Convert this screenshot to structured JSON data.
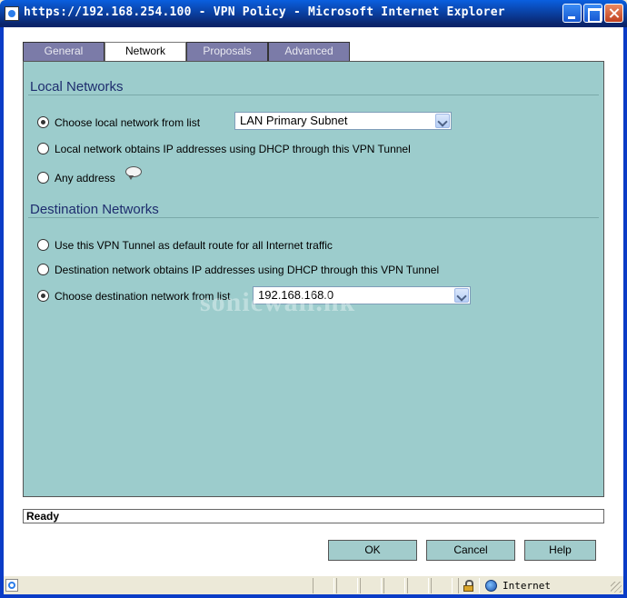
{
  "window": {
    "title": "https://192.168.254.100 - VPN Policy - Microsoft Internet Explorer"
  },
  "tabs": [
    {
      "label": "General",
      "active": false
    },
    {
      "label": "Network",
      "active": true
    },
    {
      "label": "Proposals",
      "active": false
    },
    {
      "label": "Advanced",
      "active": false
    }
  ],
  "local_networks": {
    "heading": "Local Networks",
    "options": [
      {
        "label": "Choose local network from list",
        "checked": true
      },
      {
        "label": "Local network obtains IP addresses using DHCP through this VPN Tunnel",
        "checked": false
      },
      {
        "label": "Any address",
        "checked": false
      }
    ],
    "select_value": "LAN Primary Subnet"
  },
  "destination_networks": {
    "heading": "Destination Networks",
    "options": [
      {
        "label": "Use this VPN Tunnel as default route for all Internet traffic",
        "checked": false
      },
      {
        "label": "Destination network obtains IP addresses using DHCP through this VPN Tunnel",
        "checked": false
      },
      {
        "label": "Choose destination network from list",
        "checked": true
      }
    ],
    "select_value": "192.168.168.0"
  },
  "watermark": "sonicwall.hk",
  "status_text": "Ready",
  "buttons": {
    "ok": "OK",
    "cancel": "Cancel",
    "help": "Help"
  },
  "ie_status": {
    "zone": "Internet"
  },
  "icons": [
    "ie-page-icon",
    "minimize-icon",
    "maximize-icon",
    "close-icon",
    "comment-bubble-icon",
    "lock-icon",
    "globe-icon"
  ]
}
